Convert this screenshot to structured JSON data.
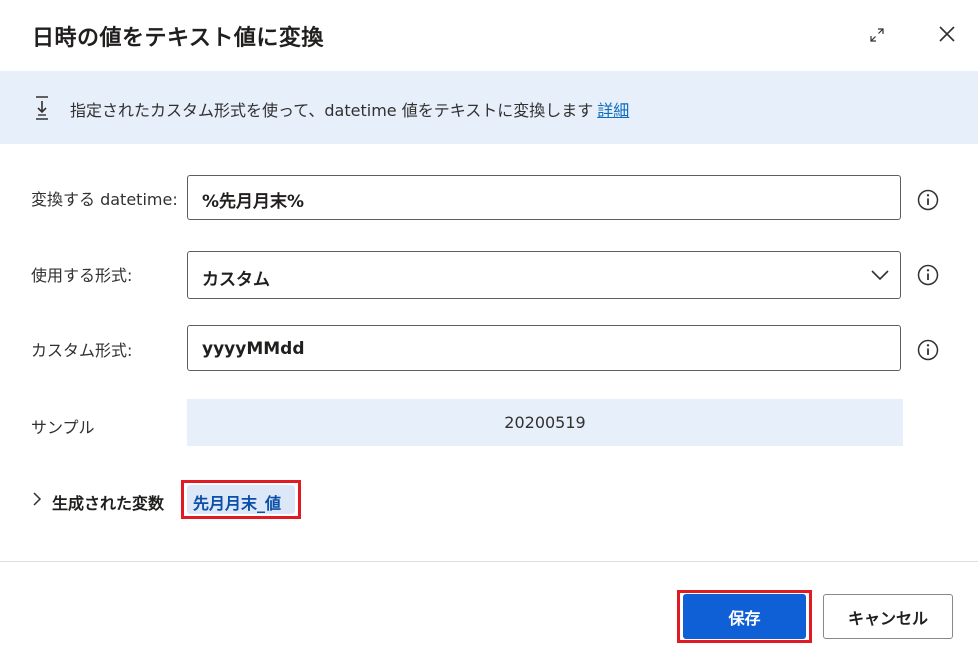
{
  "dialog": {
    "title": "日時の値をテキスト値に変換"
  },
  "banner": {
    "text": "指定されたカスタム形式を使って、datetime 値をテキストに変換します",
    "link": "詳細"
  },
  "fields": {
    "datetime": {
      "label": "変換する datetime:",
      "value": "%先月月末%"
    },
    "format": {
      "label": "使用する形式:",
      "value": "カスタム"
    },
    "custom_format": {
      "label": "カスタム形式:",
      "value": "yyyyMMdd"
    },
    "sample": {
      "label": "サンプル",
      "value": "20200519"
    }
  },
  "generated": {
    "label": "生成された変数",
    "variable": "先月月末_値"
  },
  "buttons": {
    "save": "保存",
    "cancel": "キャンセル"
  },
  "colors": {
    "accent": "#0f5fd6",
    "highlight_outline": "#e01b24",
    "banner_bg": "#e6effa"
  }
}
